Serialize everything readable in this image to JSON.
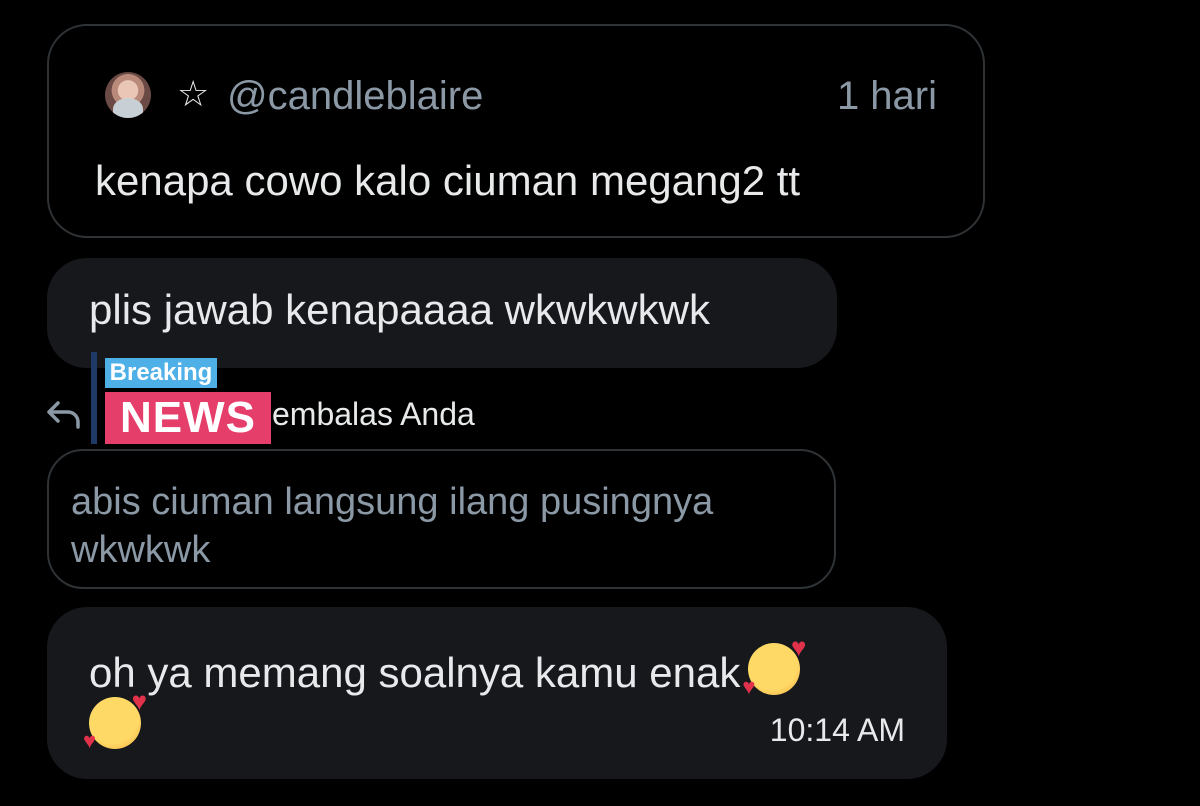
{
  "quoted_post": {
    "author_handle": "@candleblaire",
    "star_icon": "star-outline-icon",
    "time_ago": "1 hari",
    "text": "kenapa cowo kalo ciuman megang2 tt"
  },
  "messages": [
    {
      "text": "plis jawab kenapaaaa wkwkwkwk"
    }
  ],
  "reply": {
    "label_visible": "embalas Anda",
    "icon": "reply-arrow-icon",
    "quoted_text": "abis ciuman langsung ilang pusingnya wkwkwk"
  },
  "sticker": {
    "line1": "Breaking",
    "line2": "NEWS",
    "colors": {
      "breaking_bg": "#4fb0e8",
      "news_bg": "#e63e6a"
    }
  },
  "last_message": {
    "text": "oh ya memang soalnya kamu enak",
    "emoji_name": "smiling-face-with-hearts",
    "time": "10:14 AM"
  },
  "colors": {
    "background": "#000000",
    "bubble": "#16181c",
    "border": "#2f3336",
    "text_primary": "#e7e9ea",
    "text_secondary": "#8b98a5"
  }
}
